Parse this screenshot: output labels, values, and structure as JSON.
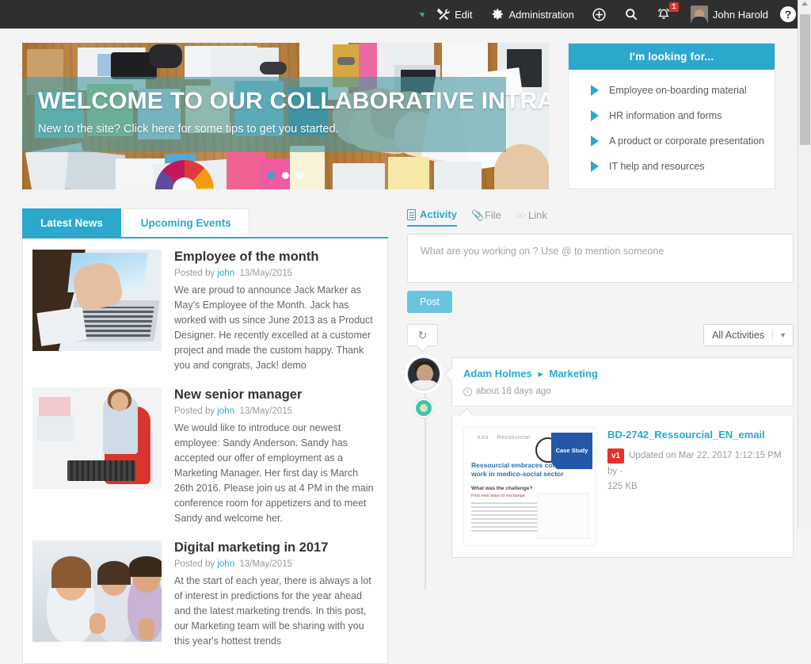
{
  "topbar": {
    "chat_icon": "chat-bubble-icon",
    "items": [
      {
        "icon": "wrench-screwdriver-icon",
        "label": "Edit"
      },
      {
        "icon": "gear-icon",
        "label": "Administration"
      }
    ],
    "plus_icon": "plus-circle-icon",
    "search_icon": "search-icon",
    "bell_icon": "bell-icon",
    "notification_count": "1",
    "user_name": "John Harold",
    "help_icon": "question-mark-icon"
  },
  "hero": {
    "title": "WELCOME TO OUR COLLABORATIVE INTRANET",
    "subtitle": "New to the site? Click here for some tips to get you started.",
    "slides": 3,
    "active_slide": 1,
    "overlay_color": "#4898a0"
  },
  "looking_for": {
    "header": "I'm looking for...",
    "header_color": "#2ca8cd",
    "items": [
      "Employee on-boarding material",
      "HR information and forms",
      "A product or corporate presentation",
      "IT help and resources"
    ]
  },
  "news": {
    "tabs": [
      {
        "label": "Latest News",
        "active": true
      },
      {
        "label": "Upcoming Events",
        "active": false
      }
    ],
    "items": [
      {
        "title": "Employee of the month",
        "posted_by_label": "Posted by",
        "author": "john",
        "date": "13/May/2015",
        "excerpt": "We are proud to announce Jack Marker as May's Employee of the Month. Jack has worked with us since June 2013 as a Product Designer. He recently excelled at a customer project and made the custom happy. Thank you and congrats, Jack! demo",
        "thumb": "hands-on-laptop-photo"
      },
      {
        "title": "New senior manager",
        "posted_by_label": "Posted by",
        "author": "john",
        "date": "13/May/2015",
        "excerpt": "We would like to introduce our newest employee: Sandy Anderson. Sandy has accepted our offer of employment as a Marketing Manager. Her first day is March 26th 2016. Please join us at 4 PM in the main conference room for appetizers and to meet Sandy and welcome her.",
        "thumb": "woman-at-desk-photo"
      },
      {
        "title": "Digital marketing in 2017",
        "posted_by_label": "Posted by",
        "author": "john",
        "date": "13/May/2015",
        "excerpt": "At the start of each year, there is always a lot of interest in predictions for the year ahead and the latest marketing trends. In this post, our Marketing team will be sharing with you this year's hottest trends",
        "thumb": "smiling-team-thumbs-up-photo"
      }
    ]
  },
  "stream": {
    "tabs": [
      {
        "label": "Activity",
        "icon": "document-icon",
        "active": true
      },
      {
        "label": "File",
        "icon": "paperclip-icon",
        "active": false
      },
      {
        "label": "Link",
        "icon": "link-icon",
        "active": false
      }
    ],
    "composer_placeholder": "What are you working on ? Use @ to mention someone",
    "post_button": "Post",
    "refresh_icon": "refresh-icon",
    "filter_value": "All Activities",
    "post": {
      "author": "Adam Holmes",
      "separator": "▸",
      "space": "Marketing",
      "time": "about 18 days ago",
      "attachment": {
        "file_name": "BD-2742_Ressourcial_EN_email",
        "version": "v1",
        "meta": "Updated on Mar 22, 2017 1:12:15 PM by -",
        "size": "125 KB",
        "preview": {
          "logo": "eXo",
          "logo_sub": "Ressourcial",
          "title": "Ressourcial embraces collaborative work in medico-social sector",
          "question": "What was the challenge?",
          "sub_question": "Find new ways to exchange",
          "badge": "Case Study"
        }
      }
    }
  }
}
